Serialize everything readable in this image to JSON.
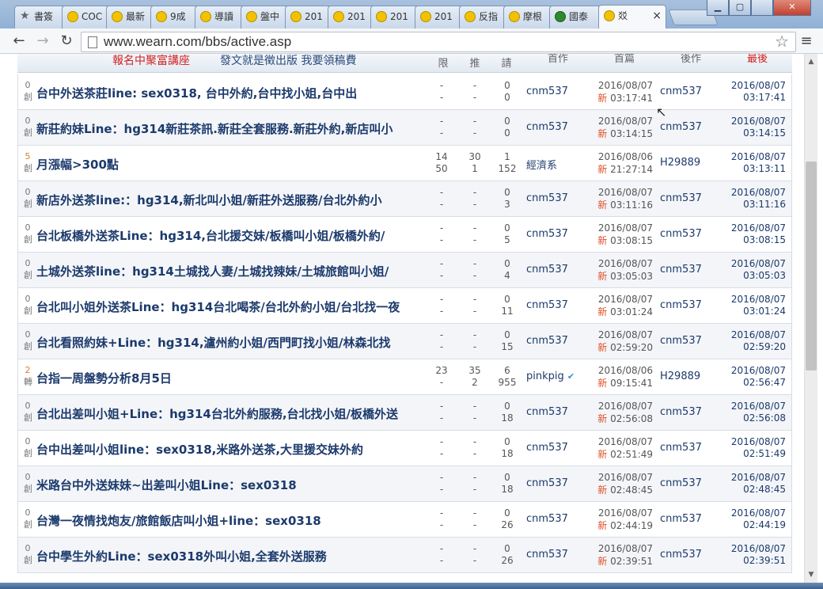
{
  "browser": {
    "tabs": [
      {
        "label": "書簽",
        "icon": "star-icon"
      },
      {
        "label": "COC",
        "icon": "wearn-icon"
      },
      {
        "label": "最新",
        "icon": "wearn-icon"
      },
      {
        "label": "9成",
        "icon": "wearn-icon"
      },
      {
        "label": "導讀",
        "icon": "wearn-icon"
      },
      {
        "label": "盤中",
        "icon": "wearn-icon"
      },
      {
        "label": "201",
        "icon": "wearn-icon"
      },
      {
        "label": "201",
        "icon": "wearn-icon"
      },
      {
        "label": "201",
        "icon": "wearn-icon"
      },
      {
        "label": "201",
        "icon": "wearn-icon"
      },
      {
        "label": "反指",
        "icon": "wearn-icon"
      },
      {
        "label": "摩根",
        "icon": "wearn-icon"
      },
      {
        "label": "國泰",
        "icon": "tree-icon"
      },
      {
        "label": "㸚",
        "icon": "wearn-icon"
      }
    ],
    "close_tab": "×",
    "url": "www.wearn.com/bbs/active.asp",
    "win_min": "▁",
    "win_max": "▢",
    "win_close": "✕"
  },
  "header": {
    "banner_red": "報名中聚富講座",
    "banner_blue": "發文就是徵出版 我要領稿費",
    "col_limit": "限",
    "col_push": "推",
    "col_reply": "請",
    "col_author": "首作",
    "col_post": "首篇",
    "col_last_author": "後作",
    "col_last": "最後"
  },
  "rows": [
    {
      "badge_n": "0",
      "badge_t": "創",
      "title": "台中外送茶莊line: sex0318, 台中外約,台中找小姐,台中出",
      "a1": "-",
      "a2": "-",
      "b1": "-",
      "b2": "-",
      "c1": "0",
      "c2": "0",
      "author": "cnm537",
      "verified": false,
      "pdate": "2016/08/07",
      "new_label": "新",
      "ptime": "03:17:41",
      "ruser": "cnm537",
      "ldate": "2016/08/07",
      "ltime": "03:17:41"
    },
    {
      "badge_n": "0",
      "badge_t": "創",
      "title": "新莊約妹Line：hg314新莊茶訊.新莊全套服務.新莊外約,新店叫小",
      "a1": "-",
      "a2": "-",
      "b1": "-",
      "b2": "-",
      "c1": "0",
      "c2": "0",
      "author": "cnm537",
      "verified": false,
      "pdate": "2016/08/07",
      "new_label": "新",
      "ptime": "03:14:15",
      "ruser": "cnm537",
      "ldate": "2016/08/07",
      "ltime": "03:14:15"
    },
    {
      "badge_n": "5",
      "badge_t": "創",
      "title": "月漲幅>300點",
      "a1": "14",
      "a2": "50",
      "b1": "30",
      "b2": "1",
      "c1": "1",
      "c2": "152",
      "author": "經濟系",
      "verified": false,
      "pdate": "2016/08/06",
      "new_label": "新",
      "ptime": "21:27:14",
      "ruser": "H29889",
      "ldate": "2016/08/07",
      "ltime": "03:13:11"
    },
    {
      "badge_n": "0",
      "badge_t": "創",
      "title": "新店外送茶line:：hg314,新北叫小姐/新莊外送服務/台北外約小",
      "a1": "-",
      "a2": "-",
      "b1": "-",
      "b2": "-",
      "c1": "0",
      "c2": "3",
      "author": "cnm537",
      "verified": false,
      "pdate": "2016/08/07",
      "new_label": "新",
      "ptime": "03:11:16",
      "ruser": "cnm537",
      "ldate": "2016/08/07",
      "ltime": "03:11:16"
    },
    {
      "badge_n": "0",
      "badge_t": "創",
      "title": "台北板橋外送茶Line：hg314,台北援交妹/板橋叫小姐/板橋外約/",
      "a1": "-",
      "a2": "-",
      "b1": "-",
      "b2": "-",
      "c1": "0",
      "c2": "5",
      "author": "cnm537",
      "verified": false,
      "pdate": "2016/08/07",
      "new_label": "新",
      "ptime": "03:08:15",
      "ruser": "cnm537",
      "ldate": "2016/08/07",
      "ltime": "03:08:15"
    },
    {
      "badge_n": "0",
      "badge_t": "創",
      "title": "土城外送茶line：hg314土城找人妻/土城找辣妹/土城旅館叫小姐/",
      "a1": "-",
      "a2": "-",
      "b1": "-",
      "b2": "-",
      "c1": "0",
      "c2": "4",
      "author": "cnm537",
      "verified": false,
      "pdate": "2016/08/07",
      "new_label": "新",
      "ptime": "03:05:03",
      "ruser": "cnm537",
      "ldate": "2016/08/07",
      "ltime": "03:05:03"
    },
    {
      "badge_n": "0",
      "badge_t": "創",
      "title": "台北叫小姐外送茶Line：hg314台北喝茶/台北外約小姐/台北找一夜",
      "a1": "-",
      "a2": "-",
      "b1": "-",
      "b2": "-",
      "c1": "0",
      "c2": "11",
      "author": "cnm537",
      "verified": false,
      "pdate": "2016/08/07",
      "new_label": "新",
      "ptime": "03:01:24",
      "ruser": "cnm537",
      "ldate": "2016/08/07",
      "ltime": "03:01:24"
    },
    {
      "badge_n": "0",
      "badge_t": "創",
      "title": "台北看照約妹+Line：hg314,瀘州約小姐/西門町找小姐/林森北找",
      "a1": "-",
      "a2": "-",
      "b1": "-",
      "b2": "-",
      "c1": "0",
      "c2": "15",
      "author": "cnm537",
      "verified": false,
      "pdate": "2016/08/07",
      "new_label": "新",
      "ptime": "02:59:20",
      "ruser": "cnm537",
      "ldate": "2016/08/07",
      "ltime": "02:59:20"
    },
    {
      "badge_n": "2",
      "badge_t": "轉",
      "title": "台指一周盤勢分析8月5日",
      "a1": "23",
      "a2": "-",
      "b1": "35",
      "b2": "2",
      "c1": "6",
      "c2": "955",
      "author": "pinkpig",
      "verified": true,
      "pdate": "2016/08/06",
      "new_label": "新",
      "ptime": "09:15:41",
      "ruser": "H29889",
      "ldate": "2016/08/07",
      "ltime": "02:56:47"
    },
    {
      "badge_n": "0",
      "badge_t": "創",
      "title": "台北出差叫小姐+Line：hg314台北外約服務,台北找小姐/板橋外送",
      "a1": "-",
      "a2": "-",
      "b1": "-",
      "b2": "-",
      "c1": "0",
      "c2": "18",
      "author": "cnm537",
      "verified": false,
      "pdate": "2016/08/07",
      "new_label": "新",
      "ptime": "02:56:08",
      "ruser": "cnm537",
      "ldate": "2016/08/07",
      "ltime": "02:56:08"
    },
    {
      "badge_n": "0",
      "badge_t": "創",
      "title": "台中出差叫小姐line：sex0318,米路外送茶,大里援交妹外約",
      "a1": "-",
      "a2": "-",
      "b1": "-",
      "b2": "-",
      "c1": "0",
      "c2": "18",
      "author": "cnm537",
      "verified": false,
      "pdate": "2016/08/07",
      "new_label": "新",
      "ptime": "02:51:49",
      "ruser": "cnm537",
      "ldate": "2016/08/07",
      "ltime": "02:51:49"
    },
    {
      "badge_n": "0",
      "badge_t": "創",
      "title": "米路台中外送妹妹~出差叫小姐Line：sex0318",
      "a1": "-",
      "a2": "-",
      "b1": "-",
      "b2": "-",
      "c1": "0",
      "c2": "18",
      "author": "cnm537",
      "verified": false,
      "pdate": "2016/08/07",
      "new_label": "新",
      "ptime": "02:48:45",
      "ruser": "cnm537",
      "ldate": "2016/08/07",
      "ltime": "02:48:45"
    },
    {
      "badge_n": "0",
      "badge_t": "創",
      "title": "台灣一夜情找炮友/旅館飯店叫小姐+line：sex0318",
      "a1": "-",
      "a2": "-",
      "b1": "-",
      "b2": "-",
      "c1": "0",
      "c2": "26",
      "author": "cnm537",
      "verified": false,
      "pdate": "2016/08/07",
      "new_label": "新",
      "ptime": "02:44:19",
      "ruser": "cnm537",
      "ldate": "2016/08/07",
      "ltime": "02:44:19"
    },
    {
      "badge_n": "0",
      "badge_t": "創",
      "title": "台中學生外約Line：sex0318外叫小姐,全套外送服務",
      "a1": "-",
      "a2": "-",
      "b1": "-",
      "b2": "-",
      "c1": "0",
      "c2": "26",
      "author": "cnm537",
      "verified": false,
      "pdate": "2016/08/07",
      "new_label": "新",
      "ptime": "02:39:51",
      "ruser": "cnm537",
      "ldate": "2016/08/07",
      "ltime": "02:39:51"
    }
  ]
}
